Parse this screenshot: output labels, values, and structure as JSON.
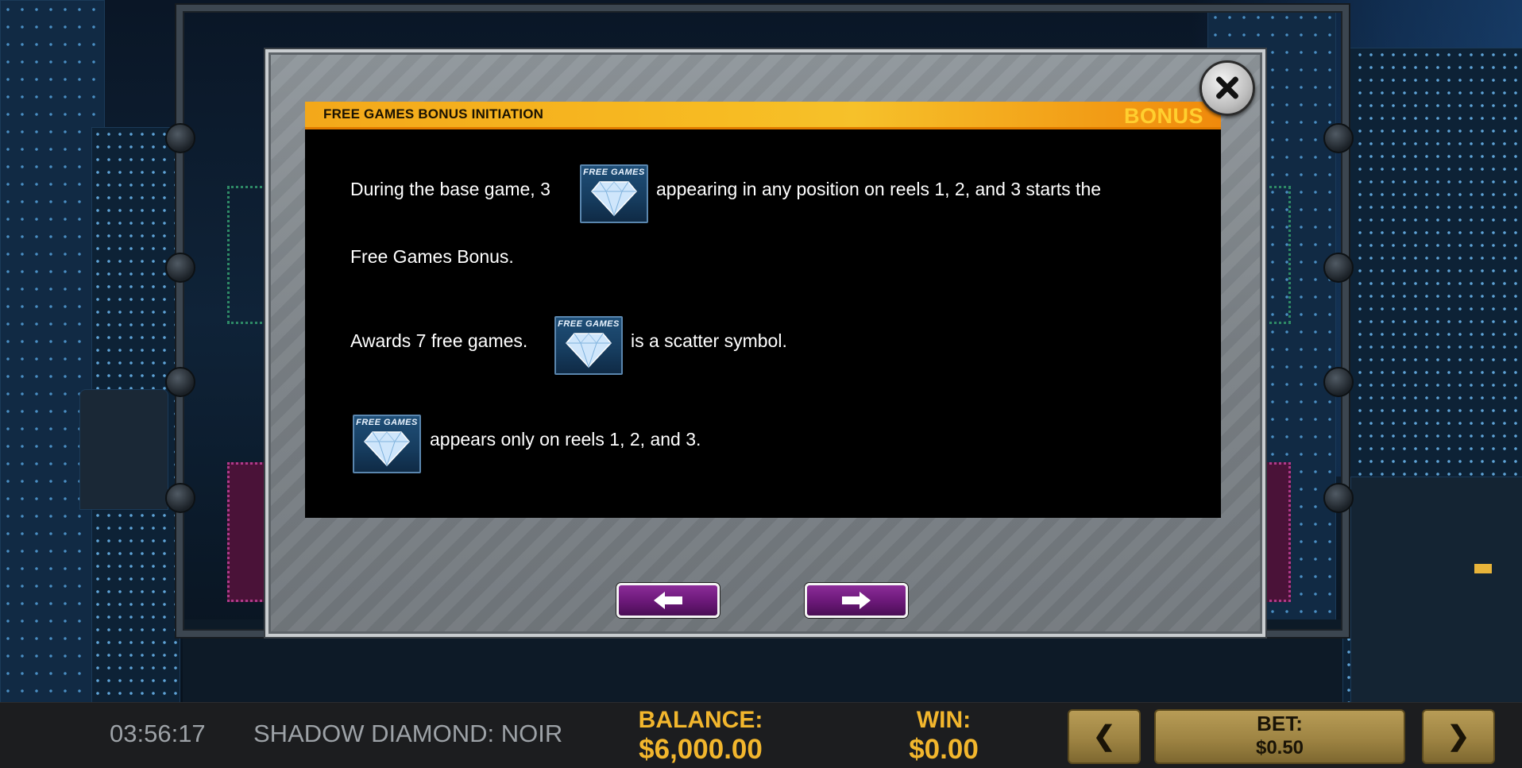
{
  "dialog": {
    "header_title": "FREE GAMES BONUS INITIATION",
    "header_tag": "BONUS",
    "symbol_label": "FREE GAMES",
    "line1_before": "During the base game, 3",
    "line1_after": "appearing in any position on reels 1, 2, and 3 starts the",
    "line2": "Free Games Bonus.",
    "line3_before": "Awards 7 free games.",
    "line3_after": "is a scatter symbol.",
    "line4_after": "appears only on reels 1, 2, and 3."
  },
  "status_bar": {
    "clock": "03:56:17",
    "game_name": "SHADOW DIAMOND: NOIR",
    "balance_label": "BALANCE:",
    "balance_value": "$6,000.00",
    "win_label": "WIN:",
    "win_value": "$0.00",
    "bet_label": "BET:",
    "bet_value": "$0.50",
    "bet_decrease_glyph": "❮",
    "bet_increase_glyph": "❯"
  },
  "colors": {
    "accent_gold": "#f2b62d",
    "header_orange": "#f7bb22",
    "nav_purple": "#6a1877"
  },
  "icons": [
    "close-icon",
    "arrow-left-icon",
    "arrow-right-icon",
    "free-games-diamond-icon"
  ]
}
